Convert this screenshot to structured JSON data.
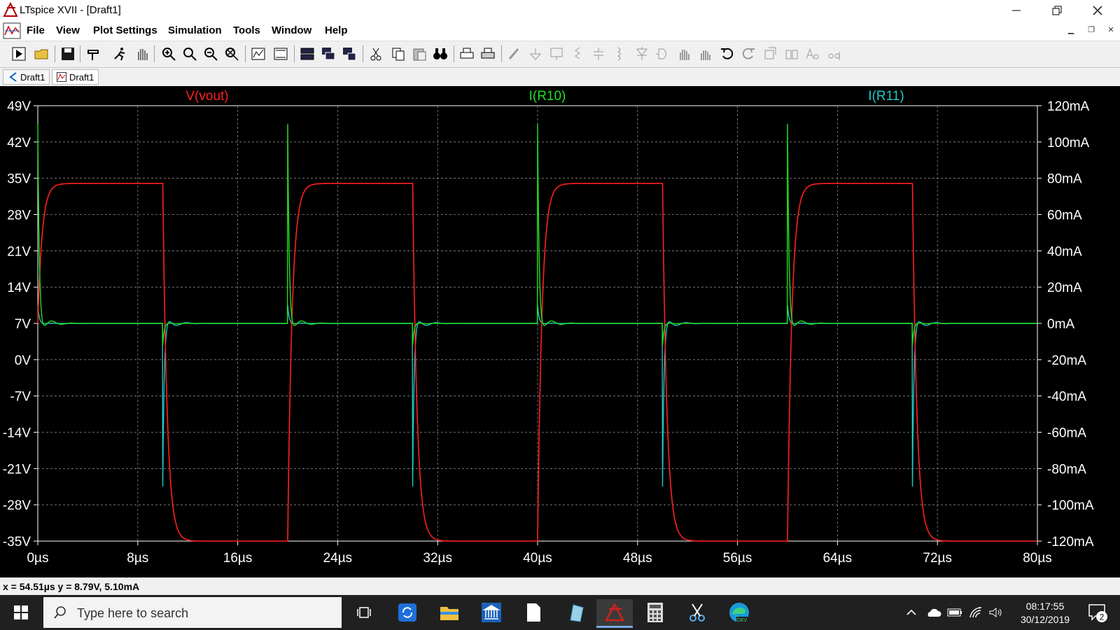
{
  "window": {
    "title": "LTspice XVII - [Draft1]"
  },
  "menu": [
    "File",
    "View",
    "Plot Settings",
    "Simulation",
    "Tools",
    "Window",
    "Help"
  ],
  "tabs": [
    {
      "label": "Draft1",
      "type": "schematic"
    },
    {
      "label": "Draft1",
      "type": "waveform",
      "active": true
    }
  ],
  "plot": {
    "traces": [
      {
        "name": "V(vout)",
        "color": "#ff2020"
      },
      {
        "name": "I(R10)",
        "color": "#20e020"
      },
      {
        "name": "I(R11)",
        "color": "#20c8c8"
      }
    ],
    "left_ticks": [
      "49V",
      "42V",
      "35V",
      "28V",
      "21V",
      "14V",
      "7V",
      "0V",
      "-7V",
      "-14V",
      "-21V",
      "-28V",
      "-35V"
    ],
    "right_ticks": [
      "120mA",
      "100mA",
      "80mA",
      "60mA",
      "40mA",
      "20mA",
      "0mA",
      "-20mA",
      "-40mA",
      "-60mA",
      "-80mA",
      "-100mA",
      "-120mA"
    ],
    "x_ticks": [
      "0µs",
      "8µs",
      "16µs",
      "24µs",
      "32µs",
      "40µs",
      "48µs",
      "56µs",
      "64µs",
      "72µs",
      "80µs"
    ]
  },
  "chart_data": {
    "type": "line",
    "x_unit": "µs",
    "xlim": [
      0,
      80
    ],
    "ylim_left": [
      -35,
      49
    ],
    "ylim_right": [
      -120,
      120
    ],
    "grid": true,
    "series": [
      {
        "name": "V(vout)",
        "axis": "left",
        "shape": "square wave",
        "high": 34,
        "low": -35,
        "rise_edges_us": [
          0,
          20,
          40,
          60
        ],
        "fall_edges_us": [
          10,
          30,
          50,
          70
        ]
      },
      {
        "name": "I(R10)",
        "axis": "right",
        "baseline": 0,
        "spike_peak": 110,
        "spike_times_us": [
          0,
          20,
          40,
          60
        ]
      },
      {
        "name": "I(R11)",
        "axis": "right",
        "baseline": 0,
        "spike_trough": -90,
        "spike_times_us": [
          10,
          30,
          50,
          70
        ]
      }
    ]
  },
  "status": {
    "cursor": "x = 54.51µs    y = 8.79V, 5.10mA"
  },
  "taskbar": {
    "search_placeholder": "Type here to search",
    "time": "08:17:55",
    "date": "30/12/2019",
    "notification_count": "2"
  }
}
